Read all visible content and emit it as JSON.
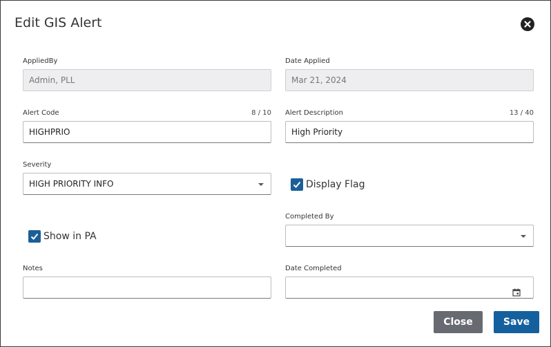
{
  "dialog": {
    "title": "Edit GIS Alert"
  },
  "colors": {
    "primary": "#14609e",
    "secondary": "#676a71",
    "checkbox": "#1b5f98"
  },
  "fields": {
    "applied_by": {
      "label": "AppliedBy",
      "value": "Admin, PLL"
    },
    "date_applied": {
      "label": "Date Applied",
      "value": "Mar 21, 2024"
    },
    "alert_code": {
      "label": "Alert Code",
      "value": "HIGHPRIO",
      "count": "8 / 10"
    },
    "alert_description": {
      "label": "Alert Description",
      "value": "High Priority",
      "count": "13 / 40"
    },
    "severity": {
      "label": "Severity",
      "value": "HIGH PRIORITY INFO"
    },
    "display_flag": {
      "label": "Display Flag",
      "checked": true
    },
    "completed_by": {
      "label": "Completed By",
      "value": ""
    },
    "show_in_pa": {
      "label": "Show in PA",
      "checked": true
    },
    "notes": {
      "label": "Notes",
      "value": ""
    },
    "date_completed": {
      "label": "Date Completed",
      "value": ""
    }
  },
  "icons": {
    "close": "close-circle-icon",
    "calendar": "calendar-icon",
    "dropdown": "chevron-down-icon",
    "check": "check-icon"
  },
  "buttons": {
    "close": "Close",
    "save": "Save"
  }
}
